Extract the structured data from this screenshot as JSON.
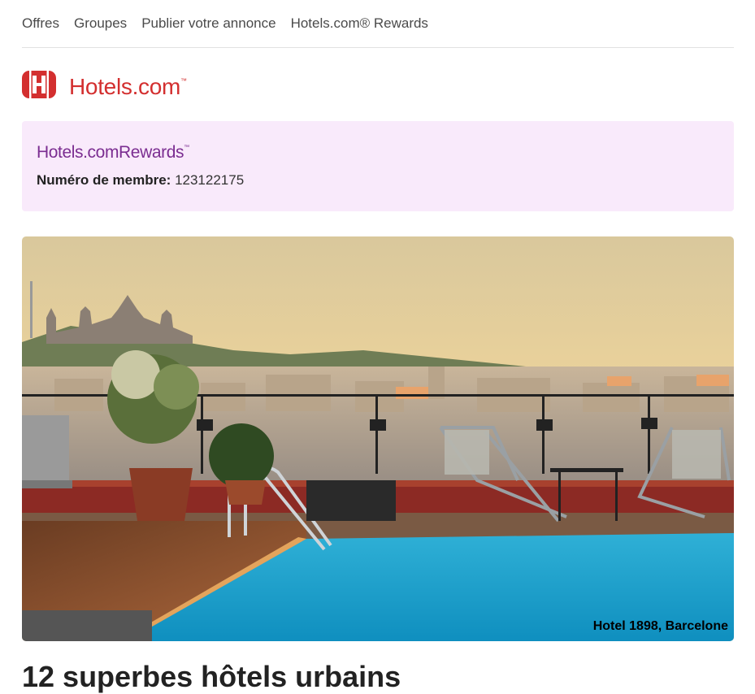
{
  "nav": {
    "items": [
      {
        "label": "Offres"
      },
      {
        "label": "Groupes"
      },
      {
        "label": "Publier votre annonce"
      },
      {
        "label": "Hotels.com® Rewards"
      }
    ]
  },
  "brand": {
    "name": "Hotels.com",
    "tm": "™",
    "color": "#d32f2f"
  },
  "rewards": {
    "brand_name": "Hotels.com",
    "brand_suffix": "Rewards",
    "tm": "™",
    "member_label": "Numéro de membre:",
    "member_number": "123122175",
    "background": "#f9eafb",
    "brand_color": "#7b2d91"
  },
  "hero": {
    "caption": "Hotel 1898, Barcelone"
  },
  "headline": "12 superbes hôtels urbains"
}
